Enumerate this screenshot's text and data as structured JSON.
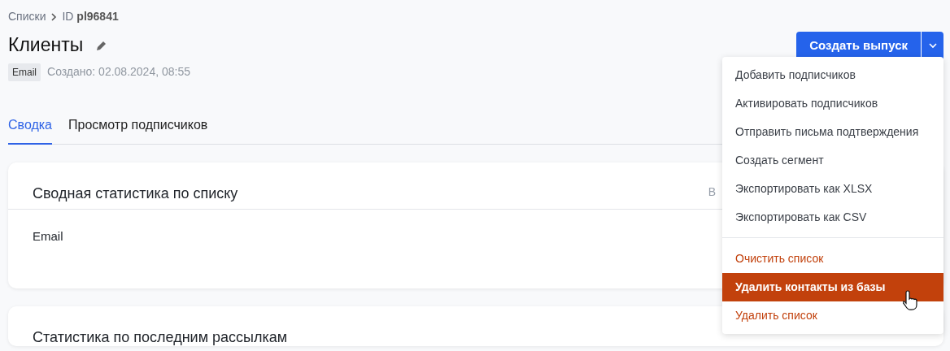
{
  "breadcrumb": {
    "parent": "Списки",
    "id_label": "ID",
    "id_value": "pl96841"
  },
  "title": "Клиенты",
  "meta": {
    "tag": "Email",
    "created": "Создано: 02.08.2024, 08:55"
  },
  "tabs": [
    {
      "label": "Сводка",
      "selected": true
    },
    {
      "label": "Просмотр подписчиков",
      "selected": false
    }
  ],
  "primary_button": {
    "label": "Создать выпуск"
  },
  "cards": [
    {
      "title": "Сводная статистика по списку",
      "aside": "В",
      "body": "Email"
    },
    {
      "title": "Статистика по последним рассылкам"
    }
  ],
  "menu": {
    "groups": [
      [
        {
          "label": "Добавить подписчиков",
          "kind": "normal",
          "selected": false
        },
        {
          "label": "Активировать подписчиков",
          "kind": "normal",
          "selected": false
        },
        {
          "label": "Отправить письма подтверждения",
          "kind": "normal",
          "selected": false
        },
        {
          "label": "Создать сегмент",
          "kind": "normal",
          "selected": false
        },
        {
          "label": "Экспортировать как XLSX",
          "kind": "normal",
          "selected": false
        },
        {
          "label": "Экспортировать как CSV",
          "kind": "normal",
          "selected": false
        }
      ],
      [
        {
          "label": "Очистить список",
          "kind": "danger",
          "selected": false
        },
        {
          "label": "Удалить контакты из базы",
          "kind": "danger",
          "selected": true
        },
        {
          "label": "Удалить список",
          "kind": "danger",
          "selected": false
        }
      ]
    ]
  }
}
